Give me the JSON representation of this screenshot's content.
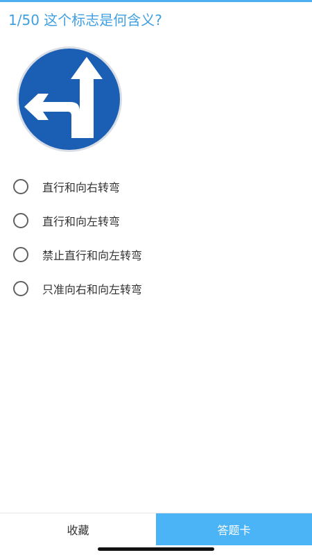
{
  "question": {
    "progress": "1/50",
    "text": "这个标志是何含义?"
  },
  "sign": {
    "icon": "traffic-sign-straight-or-left-turn-icon",
    "circle_color": "#1a5fb4",
    "arrow_color": "#ffffff"
  },
  "options": [
    {
      "label": "直行和向右转弯"
    },
    {
      "label": "直行和向左转弯"
    },
    {
      "label": "禁止直行和向左转弯"
    },
    {
      "label": "只准向右和向左转弯"
    }
  ],
  "bottom_bar": {
    "favorite_label": "收藏",
    "answer_card_label": "答题卡",
    "accent_color": "#4ab4f7"
  }
}
